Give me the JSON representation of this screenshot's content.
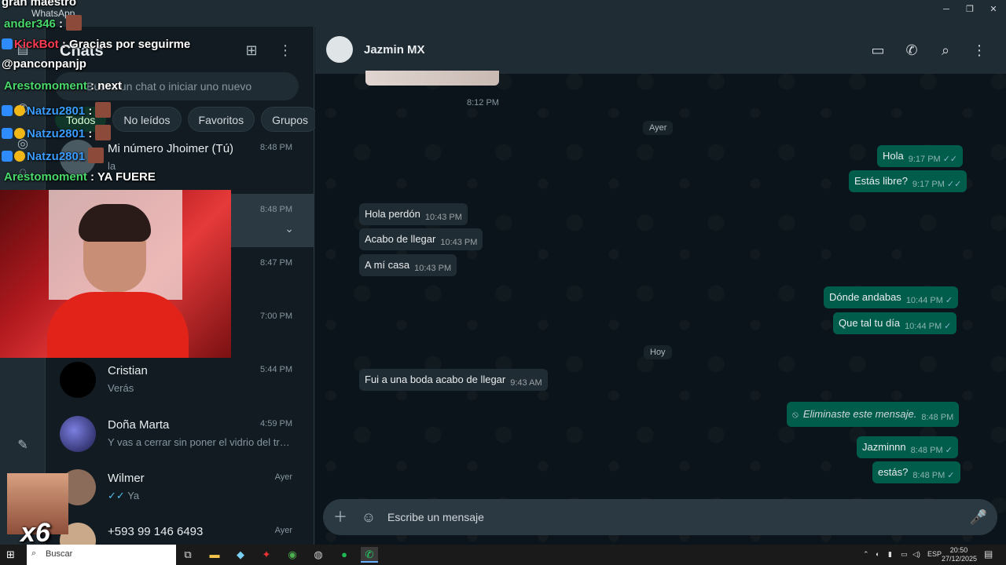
{
  "window": {
    "app_title": "WhatsApp"
  },
  "sidebar": {
    "title": "Chats",
    "search_placeholder": "Busca un chat o iniciar uno nuevo",
    "filters": [
      "Todos",
      "No leídos",
      "Favoritos",
      "Grupos"
    ],
    "active_filter": "Todos",
    "chats": [
      {
        "name": "Mi número Jhoimer (Tú)",
        "preview": "la",
        "time": "8:48 PM"
      },
      {
        "name": "",
        "preview": "",
        "time": "8:48 PM"
      },
      {
        "name": "",
        "preview": "",
        "time": "8:47 PM"
      },
      {
        "name": "",
        "preview": "",
        "time": "7:00 PM"
      },
      {
        "name": "Cristian",
        "preview": "Verás",
        "time": "5:44 PM"
      },
      {
        "name": "Doña Marta",
        "preview": "Y vas a cerrar sin poner el vidrio del trái...",
        "time": "4:59 PM"
      },
      {
        "name": "Wilmer",
        "preview": "Ya",
        "time": "Ayer"
      },
      {
        "name": "+593 99 146 6493",
        "preview": "",
        "time": "Ayer"
      }
    ]
  },
  "chat": {
    "contact_name": "Jazmin MX",
    "media_time": "8:12 PM",
    "day_labels": {
      "yesterday": "Ayer",
      "today": "Hoy"
    },
    "messages": [
      {
        "dir": "out",
        "text": "Hola",
        "time": "9:17 PM"
      },
      {
        "dir": "out",
        "text": "Estás libre?",
        "time": "9:17 PM"
      },
      {
        "dir": "in",
        "text": "Hola perdón",
        "time": "10:43 PM"
      },
      {
        "dir": "in",
        "text": "Acabo de llegar",
        "time": "10:43 PM"
      },
      {
        "dir": "in",
        "text": "A mí casa",
        "time": "10:43 PM"
      },
      {
        "dir": "out",
        "text": "Dónde andabas",
        "time": "10:44 PM"
      },
      {
        "dir": "out",
        "text": "Que tal tu día",
        "time": "10:44 PM"
      },
      {
        "dir": "in",
        "text": "Fui a una boda acabo de llegar",
        "time": "9:43 AM"
      },
      {
        "dir": "out",
        "text": "Eliminaste este mensaje.",
        "time": "8:48 PM",
        "deleted": true
      },
      {
        "dir": "out",
        "text": "Jazminnn",
        "time": "8:48 PM"
      },
      {
        "dir": "out",
        "text": "estás?",
        "time": "8:48 PM"
      }
    ],
    "composer_placeholder": "Escribe un mensaje"
  },
  "stream_overlay": {
    "top_text": "gran maestro",
    "chat_lines": [
      {
        "user": "ander346",
        "text": ""
      },
      {
        "user": "KickBot",
        "text": "Gracias por seguirme"
      },
      {
        "user": "@panconpanjp",
        "text": ""
      },
      {
        "user": "Arestomoment",
        "text": "next"
      },
      {
        "user": "Natzu2801",
        "text": ""
      },
      {
        "user": "Natzu2801",
        "text": ""
      },
      {
        "user": "Natzu2801",
        "text": ""
      },
      {
        "user": "Arestomoment",
        "text": "YA FUERE"
      }
    ],
    "reaction_count": "x6"
  },
  "taskbar": {
    "search_label": "Buscar",
    "language": "ESP",
    "time": "20:50",
    "date": "27/12/2025"
  },
  "colors": {
    "background": "#111b21",
    "panel": "#202c33",
    "outgoing_bubble": "#005c4b",
    "incoming_bubble": "#202c33",
    "active_chip": "#103529",
    "overlay_green": "#49d86b",
    "overlay_blue": "#3b9cff"
  }
}
